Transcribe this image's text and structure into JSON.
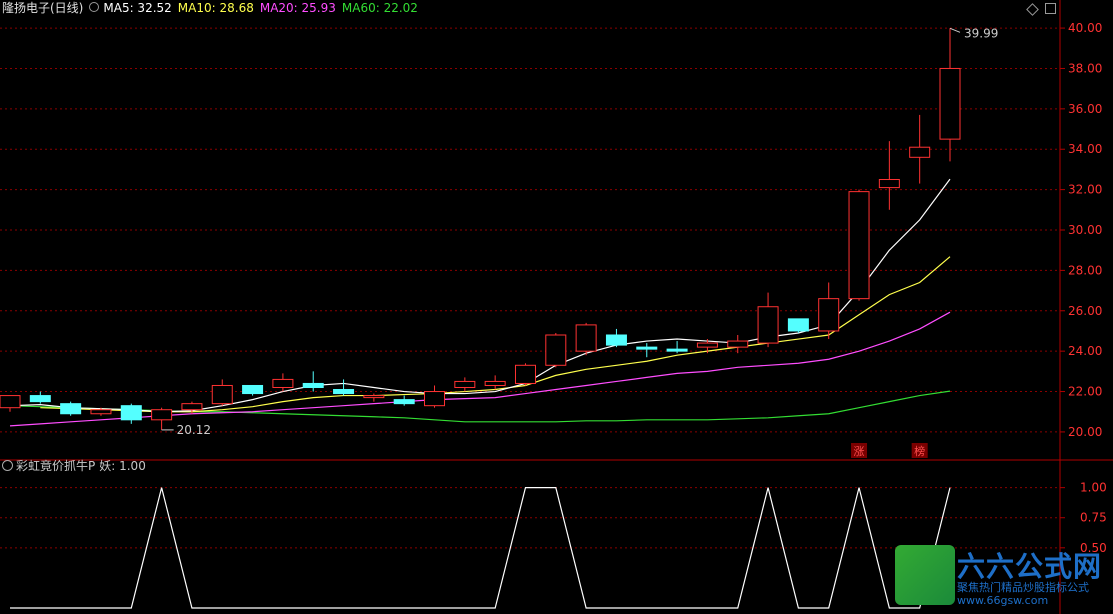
{
  "header": {
    "stock_name": "隆扬电子(日线)",
    "ma5": "MA5: 32.52",
    "ma10": "MA10: 28.68",
    "ma20": "MA20: 25.93",
    "ma60": "MA60: 22.02"
  },
  "sub_header": {
    "indicator": "彩虹竟价抓牛P",
    "value": "妖: 1.00"
  },
  "colors": {
    "up": "#ff3232",
    "down": "#54ffff",
    "ma5": "#ffffff",
    "ma10": "#ffff4d",
    "ma20": "#ff4dff",
    "ma60": "#33dd33",
    "grid": "#8b0000",
    "axis": "#b00000"
  },
  "markers": {
    "high_label": "39.99",
    "low_label": "20.12",
    "tag_zhang": "涨",
    "tag_bang": "榜"
  },
  "logo": {
    "title": "六六公式网",
    "tagline": "聚焦热门精品炒股指标公式",
    "url": "www.66gsw.com"
  },
  "chart_data": [
    {
      "type": "candlestick",
      "title": "",
      "ylim": [
        19.6,
        40.4
      ],
      "yticks": [
        "20.00",
        "22.00",
        "24.00",
        "26.00",
        "28.00",
        "30.00",
        "32.00",
        "34.00",
        "36.00",
        "38.00",
        "40.00"
      ],
      "grid": true,
      "candles": [
        {
          "o": 21.2,
          "h": 21.8,
          "l": 21.0,
          "c": 21.8
        },
        {
          "o": 21.8,
          "h": 22.0,
          "l": 21.4,
          "c": 21.5
        },
        {
          "o": 21.4,
          "h": 21.5,
          "l": 20.8,
          "c": 20.9
        },
        {
          "o": 20.9,
          "h": 21.2,
          "l": 20.8,
          "c": 21.1
        },
        {
          "o": 21.3,
          "h": 21.4,
          "l": 20.4,
          "c": 20.6
        },
        {
          "o": 20.6,
          "h": 21.2,
          "l": 20.1,
          "c": 21.1
        },
        {
          "o": 21.1,
          "h": 21.5,
          "l": 20.9,
          "c": 21.4
        },
        {
          "o": 21.4,
          "h": 22.6,
          "l": 21.3,
          "c": 22.3
        },
        {
          "o": 22.3,
          "h": 22.3,
          "l": 21.8,
          "c": 21.9
        },
        {
          "o": 22.2,
          "h": 22.9,
          "l": 22.0,
          "c": 22.6
        },
        {
          "o": 22.4,
          "h": 23.0,
          "l": 22.0,
          "c": 22.2
        },
        {
          "o": 22.1,
          "h": 22.6,
          "l": 21.8,
          "c": 21.9
        },
        {
          "o": 21.7,
          "h": 21.9,
          "l": 21.5,
          "c": 21.8
        },
        {
          "o": 21.6,
          "h": 21.8,
          "l": 21.3,
          "c": 21.4
        },
        {
          "o": 21.3,
          "h": 22.3,
          "l": 21.2,
          "c": 22.0
        },
        {
          "o": 22.2,
          "h": 22.7,
          "l": 22.0,
          "c": 22.5
        },
        {
          "o": 22.3,
          "h": 22.8,
          "l": 22.1,
          "c": 22.5
        },
        {
          "o": 22.4,
          "h": 23.4,
          "l": 22.3,
          "c": 23.3
        },
        {
          "o": 23.3,
          "h": 24.9,
          "l": 23.2,
          "c": 24.8
        },
        {
          "o": 24.0,
          "h": 25.4,
          "l": 23.8,
          "c": 25.3
        },
        {
          "o": 24.8,
          "h": 25.1,
          "l": 24.2,
          "c": 24.3
        },
        {
          "o": 24.2,
          "h": 24.4,
          "l": 23.7,
          "c": 24.1
        },
        {
          "o": 24.1,
          "h": 24.5,
          "l": 23.9,
          "c": 24.0
        },
        {
          "o": 24.2,
          "h": 24.6,
          "l": 23.9,
          "c": 24.4
        },
        {
          "o": 24.2,
          "h": 24.8,
          "l": 23.9,
          "c": 24.5
        },
        {
          "o": 24.4,
          "h": 26.9,
          "l": 24.2,
          "c": 26.2
        },
        {
          "o": 25.6,
          "h": 25.6,
          "l": 24.9,
          "c": 25.0
        },
        {
          "o": 25.0,
          "h": 27.4,
          "l": 24.6,
          "c": 26.6
        },
        {
          "o": 26.6,
          "h": 32.0,
          "l": 26.5,
          "c": 31.9
        },
        {
          "o": 32.1,
          "h": 34.4,
          "l": 31.0,
          "c": 32.5
        },
        {
          "o": 33.6,
          "h": 35.7,
          "l": 32.3,
          "c": 34.1
        },
        {
          "o": 34.5,
          "h": 39.99,
          "l": 33.4,
          "c": 38.0
        }
      ],
      "ma5": [
        21.3,
        21.35,
        21.2,
        21.15,
        21.1,
        21.0,
        21.05,
        21.3,
        21.6,
        22.0,
        22.3,
        22.4,
        22.2,
        22.0,
        21.9,
        21.9,
        22.0,
        22.4,
        23.3,
        23.9,
        24.3,
        24.5,
        24.6,
        24.5,
        24.4,
        24.7,
        24.9,
        25.3,
        27.0,
        29.0,
        30.5,
        32.52
      ],
      "ma10": [
        null,
        21.2,
        21.15,
        21.1,
        21.05,
        21.0,
        21.0,
        21.1,
        21.25,
        21.5,
        21.7,
        21.8,
        21.8,
        21.85,
        21.9,
        22.0,
        22.1,
        22.3,
        22.8,
        23.1,
        23.3,
        23.5,
        23.8,
        24.0,
        24.2,
        24.4,
        24.6,
        24.8,
        25.8,
        26.8,
        27.4,
        28.68
      ],
      "ma20": [
        20.3,
        20.4,
        20.5,
        20.6,
        20.7,
        20.8,
        20.9,
        20.95,
        21.0,
        21.1,
        21.2,
        21.3,
        21.4,
        21.5,
        21.6,
        21.65,
        21.7,
        21.9,
        22.1,
        22.3,
        22.5,
        22.7,
        22.9,
        23.0,
        23.2,
        23.3,
        23.4,
        23.6,
        24.0,
        24.5,
        25.1,
        25.93
      ],
      "ma60": [
        21.3,
        21.25,
        21.2,
        21.15,
        21.1,
        21.05,
        21.0,
        21.0,
        20.95,
        20.9,
        20.85,
        20.8,
        20.75,
        20.7,
        20.6,
        20.5,
        20.5,
        20.5,
        20.5,
        20.55,
        20.55,
        20.6,
        20.6,
        20.6,
        20.65,
        20.7,
        20.8,
        20.9,
        21.2,
        21.5,
        21.8,
        22.02
      ]
    },
    {
      "type": "line",
      "title": "",
      "ylim": [
        0,
        1.08
      ],
      "yticks": [
        "0.50",
        "0.75",
        "1.00"
      ],
      "grid": true,
      "values": [
        0,
        0,
        0,
        0,
        0,
        1,
        0,
        0,
        0,
        0,
        0,
        0,
        0,
        0,
        0,
        0,
        0,
        1,
        1,
        0,
        0,
        0,
        0,
        0,
        0,
        1,
        0,
        0,
        1,
        0,
        0,
        1
      ]
    }
  ]
}
